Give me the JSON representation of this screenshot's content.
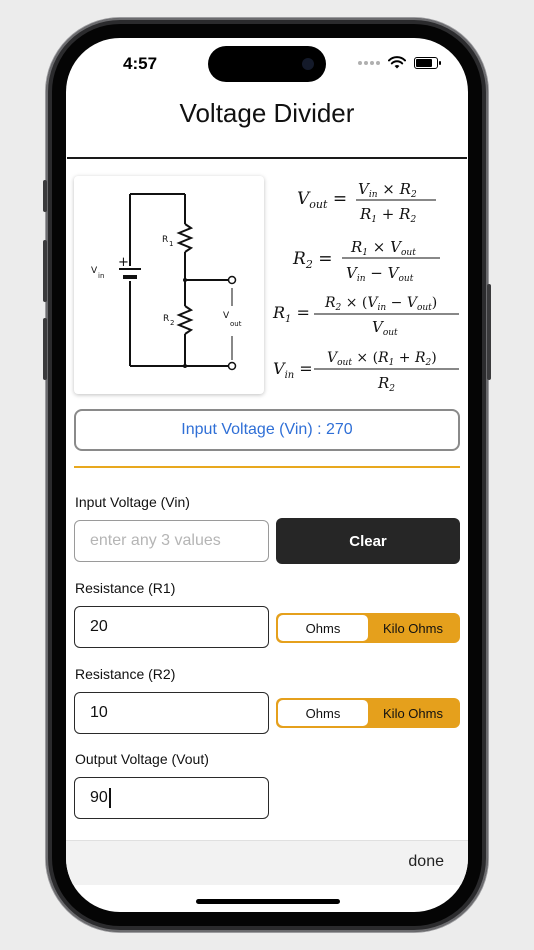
{
  "status": {
    "time": "4:57"
  },
  "header": {
    "title": "Voltage Divider"
  },
  "circuit": {
    "label_vin": "V",
    "label_vin_sub": "in",
    "label_r1": "R",
    "label_r1_sub": "1",
    "label_r2": "R",
    "label_r2_sub": "2",
    "label_vout": "V",
    "label_vout_sub": "out",
    "plus": "+"
  },
  "result": {
    "text": "Input Voltage (Vin) : 270"
  },
  "form": {
    "vin": {
      "label": "Input Voltage (Vin)",
      "value": "",
      "placeholder": "enter any 3 values"
    },
    "clear_label": "Clear",
    "r1": {
      "label": "Resistance (R1)",
      "value": "20",
      "unit_options": [
        "Ohms",
        "Kilo Ohms"
      ],
      "selected_unit": "Ohms"
    },
    "r2": {
      "label": "Resistance (R2)",
      "value": "10",
      "unit_options": [
        "Ohms",
        "Kilo Ohms"
      ],
      "selected_unit": "Ohms"
    },
    "vout": {
      "label": "Output Voltage (Vout)",
      "value": "90"
    }
  },
  "keyboard_toolbar": {
    "done_label": "done"
  },
  "colors": {
    "accent": "#e5a01c",
    "result_text": "#2f6fd6",
    "button_dark": "#262626"
  }
}
